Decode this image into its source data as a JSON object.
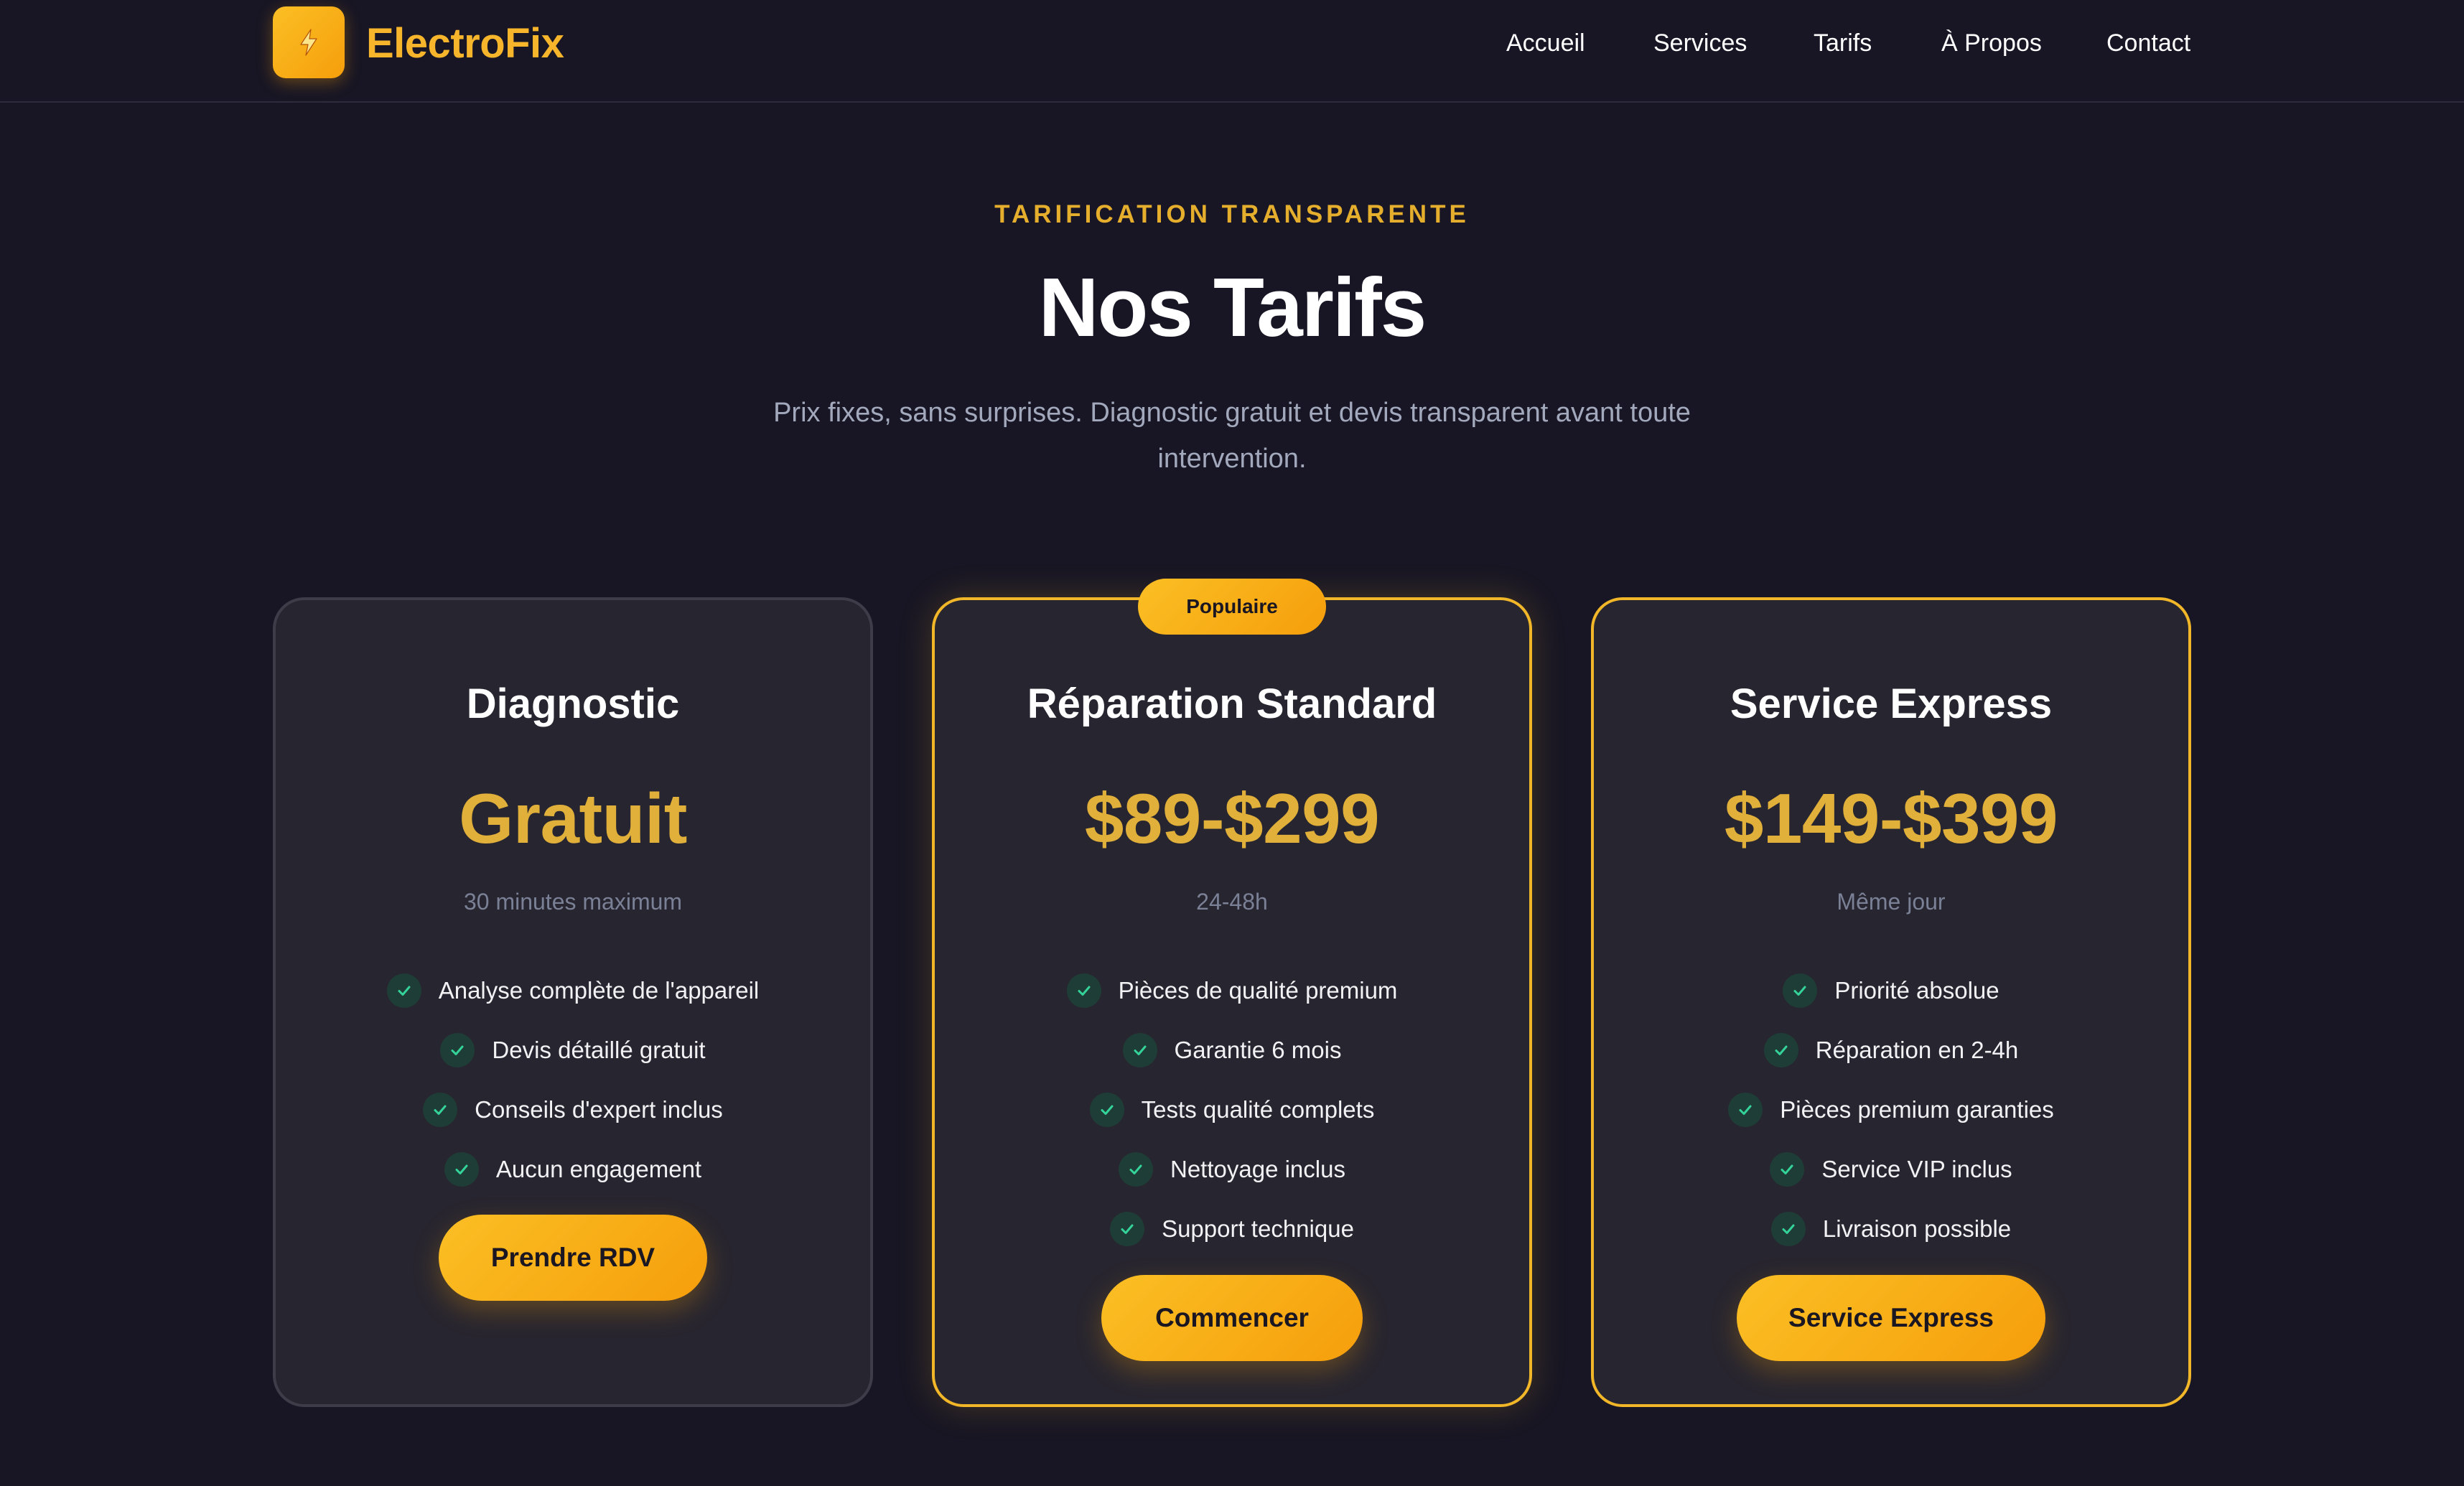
{
  "brand": {
    "name": "ElectroFix",
    "logo_icon": "lightning-bolt-icon",
    "accent_color": "#f6b52b"
  },
  "nav": {
    "items": [
      "Accueil",
      "Services",
      "Tarifs",
      "À Propos",
      "Contact"
    ]
  },
  "hero": {
    "eyebrow": "TARIFICATION TRANSPARENTE",
    "title": "Nos Tarifs",
    "subtitle": "Prix fixes, sans surprises. Diagnostic gratuit et devis transparent avant toute intervention."
  },
  "plans": [
    {
      "name": "Diagnostic",
      "price": "Gratuit",
      "duration": "30 minutes maximum",
      "features": [
        "Analyse complète de l'appareil",
        "Devis détaillé gratuit",
        "Conseils d'expert inclus",
        "Aucun engagement"
      ],
      "cta": "Prendre RDV"
    },
    {
      "badge": "Populaire",
      "name": "Réparation Standard",
      "price": "$89-$299",
      "duration": "24-48h",
      "features": [
        "Pièces de qualité premium",
        "Garantie 6 mois",
        "Tests qualité complets",
        "Nettoyage inclus",
        "Support technique"
      ],
      "cta": "Commencer"
    },
    {
      "name": "Service Express",
      "price": "$149-$399",
      "duration": "Même jour",
      "features": [
        "Priorité absolue",
        "Réparation en 2-4h",
        "Pièces premium garanties",
        "Service VIP inclus",
        "Livraison possible"
      ],
      "cta": "Service Express"
    }
  ],
  "colors": {
    "background": "#181624",
    "card": "#27252f",
    "price": "#e1b03a",
    "check": "#34d399"
  }
}
